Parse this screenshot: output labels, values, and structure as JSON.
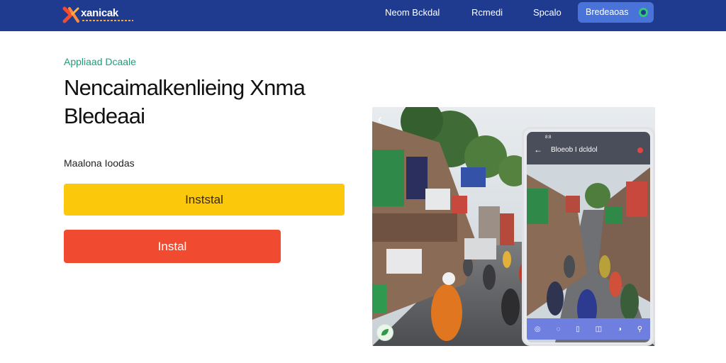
{
  "header": {
    "logo_text": "xanicak",
    "nav": [
      "Neom Bckdal",
      "Rcmedi",
      "Spcalo"
    ],
    "cta_label": "Bredeaoas"
  },
  "main": {
    "eyebrow": "Appliaad Dcaale",
    "headline": "Nencaimalkenlieing Xnma Bledeaai",
    "subtext": "Maalona Ioodas",
    "primary_button": "Inststal",
    "secondary_button": "Instal"
  },
  "phone": {
    "status": "8:8",
    "title": "Bloeob I dcldol"
  },
  "colors": {
    "nav_bg": "#1f3b8f",
    "eyebrow": "#1e9c78",
    "primary_button": "#fcc80b",
    "secondary_button": "#f04a30",
    "phone_nav": "#6f7fe0"
  }
}
